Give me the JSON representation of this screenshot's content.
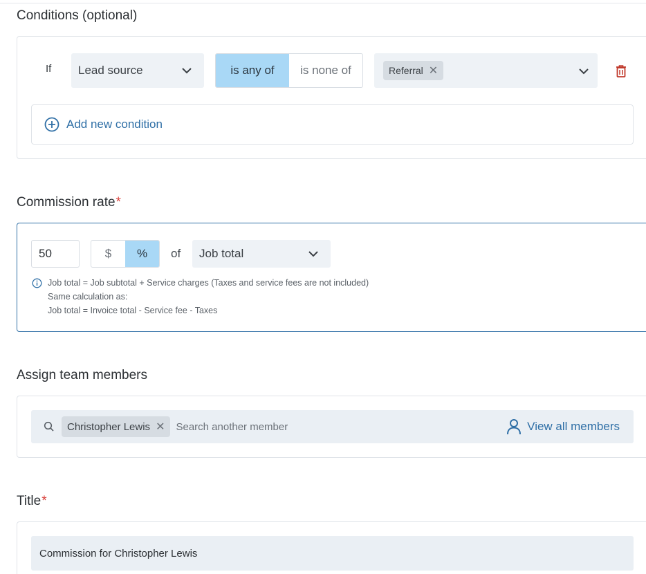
{
  "conditions": {
    "title": "Conditions (optional)",
    "if_label": "If",
    "field_select": "Lead source",
    "operator_options": [
      "is any of",
      "is none of"
    ],
    "operator_selected": "is any of",
    "values": [
      "Referral"
    ],
    "add_label": "Add new condition"
  },
  "commission": {
    "title": "Commission rate",
    "required_mark": "*",
    "rate_value": "50",
    "unit_options": [
      "$",
      "%"
    ],
    "unit_selected": "%",
    "of_label": "of",
    "basis_select": "Job total",
    "info_lines": [
      "Job total = Job subtotal + Service charges (Taxes and service fees are not included)",
      "Same calculation as:",
      "Job total = Invoice total - Service fee - Taxes"
    ]
  },
  "team": {
    "title": "Assign team members",
    "members": [
      "Christopher Lewis"
    ],
    "search_placeholder": "Search another member",
    "view_all_label": "View all members"
  },
  "title_field": {
    "title": "Title",
    "required_mark": "*",
    "value": "Commission for Christopher Lewis"
  },
  "colors": {
    "accent": "#2f6fa6",
    "selected_segment": "#a9d8f6",
    "required": "#d9413b",
    "danger": "#c0392b"
  },
  "icons": [
    "chevron-down-icon",
    "remove-x-icon",
    "trash-icon",
    "add-circle-icon",
    "info-icon",
    "search-icon",
    "person-icon"
  ]
}
